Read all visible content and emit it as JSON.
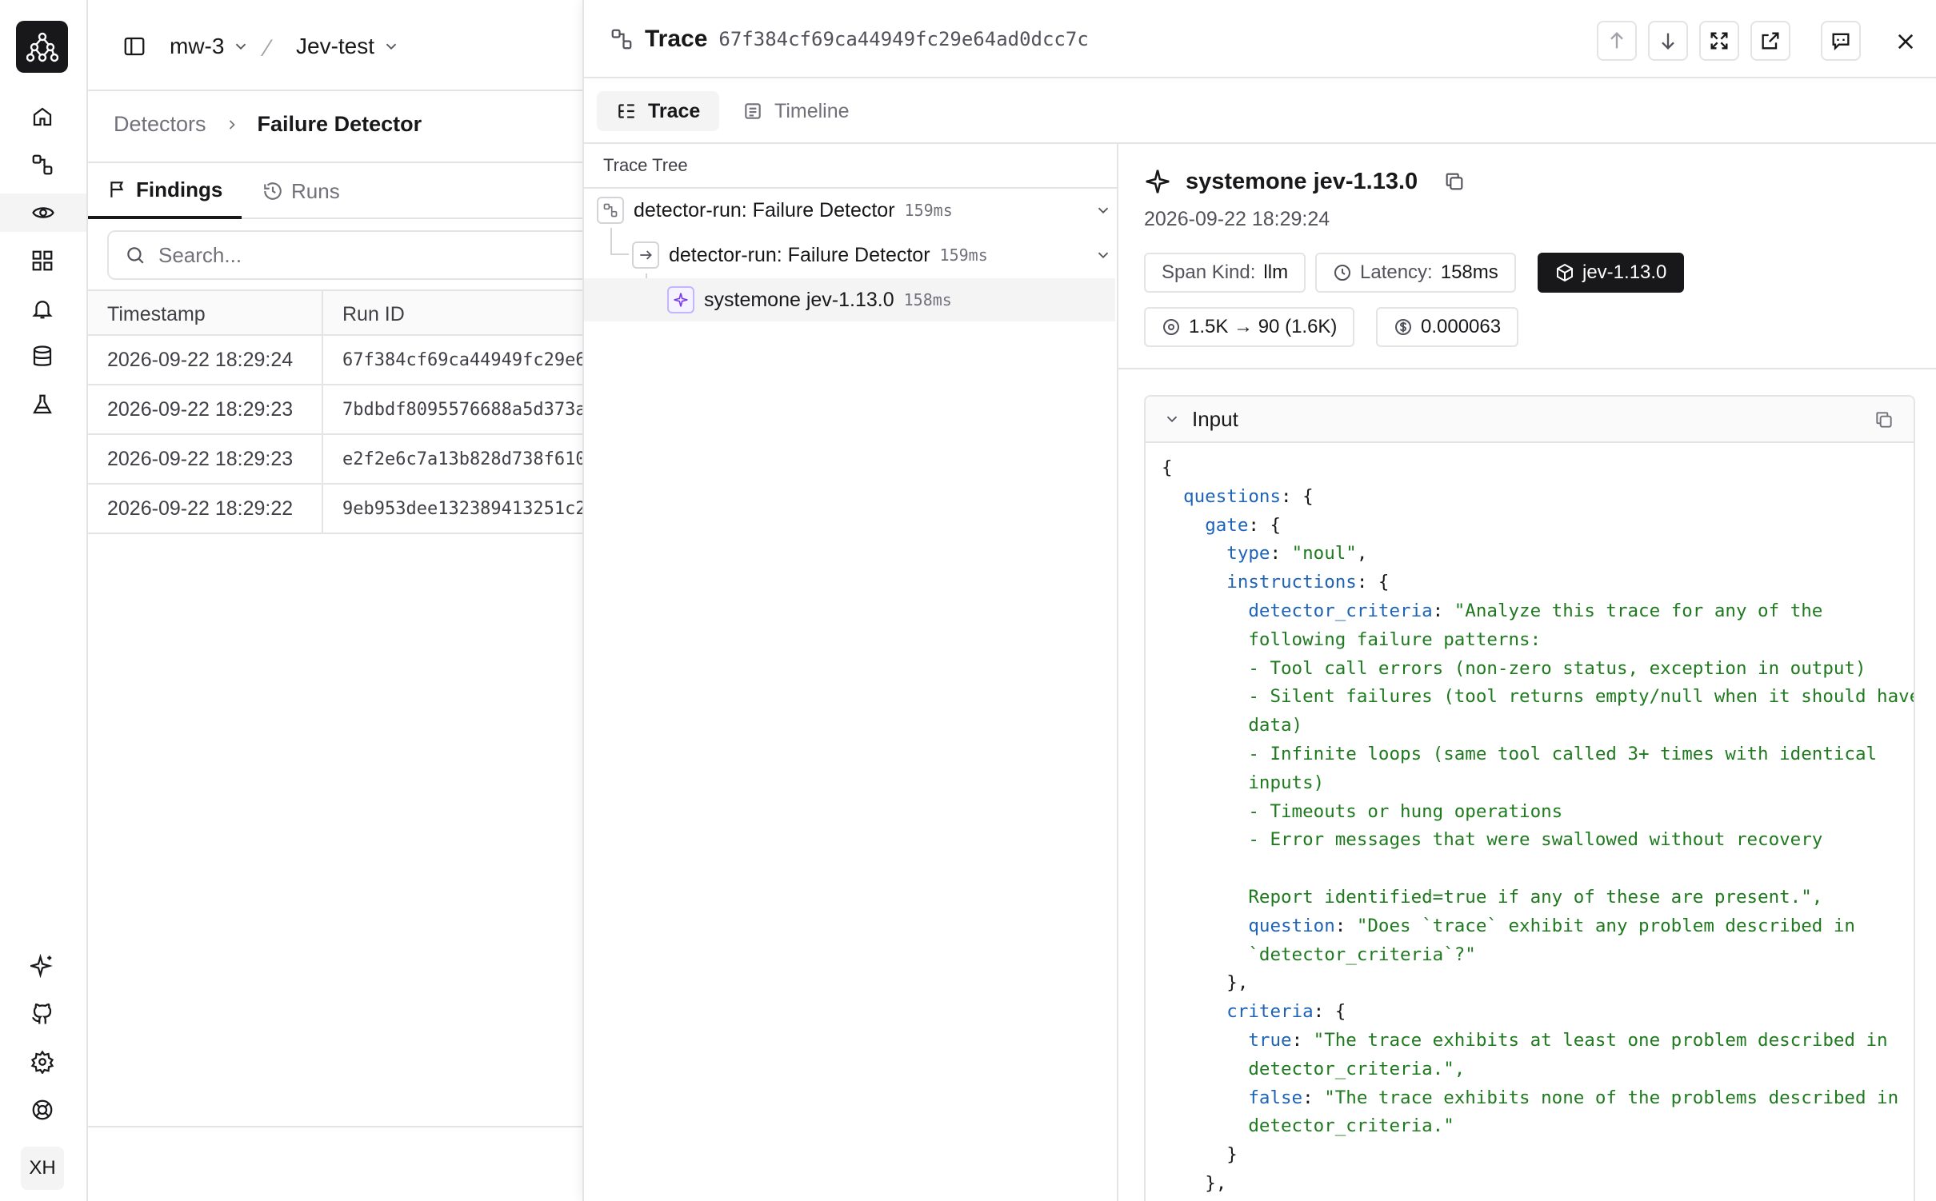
{
  "workspace": {
    "org": "mw-3",
    "project": "Jev-test"
  },
  "user": {
    "initials": "XH"
  },
  "rail": {
    "top_icons": [
      "home-icon",
      "traces-icon",
      "eye-icon",
      "dashboard-icon",
      "bell-icon",
      "database-icon",
      "flask-icon"
    ],
    "active": "eye-icon",
    "bottom_icons": [
      "sparkle-icon",
      "github-icon",
      "settings-icon",
      "help-icon"
    ]
  },
  "breadcrumb": {
    "parent": "Detectors",
    "current": "Failure Detector"
  },
  "tabs": {
    "findings": "Findings",
    "runs": "Runs"
  },
  "search": {
    "placeholder": "Search..."
  },
  "runs_table": {
    "columns": [
      "Timestamp",
      "Run ID"
    ],
    "rows": [
      {
        "timestamp": "2026-09-22 18:29:24",
        "run_id": "67f384cf69ca44949fc29e6"
      },
      {
        "timestamp": "2026-09-22 18:29:23",
        "run_id": "7bdbdf8095576688a5d373a"
      },
      {
        "timestamp": "2026-09-22 18:29:23",
        "run_id": "e2f2e6c7a13b828d738f610"
      },
      {
        "timestamp": "2026-09-22 18:29:22",
        "run_id": "9eb953dee132389413251c2"
      }
    ]
  },
  "drawer": {
    "title": "Trace",
    "trace_id": "67f384cf69ca44949fc29e64ad0dcc7c",
    "tabs": {
      "trace": "Trace",
      "timeline": "Timeline"
    },
    "tree_title": "Trace Tree",
    "nodes": [
      {
        "name": "detector-run: Failure Detector",
        "duration": "159ms"
      },
      {
        "name": "detector-run: Failure Detector",
        "duration": "159ms"
      },
      {
        "name": "systemone jev-1.13.0",
        "duration": "158ms"
      }
    ],
    "span": {
      "name": "systemone jev-1.13.0",
      "timestamp": "2026-09-22 18:29:24",
      "kind_label": "Span Kind:",
      "kind": "llm",
      "latency_label": "Latency:",
      "latency": "158ms",
      "version": "jev-1.13.0",
      "tokens": "1.5K → 90 (1.6K)",
      "cost": "0.000063"
    },
    "input_label": "Input",
    "input_code": {
      "l0": "{",
      "k_questions": "questions",
      "k_gate": "gate",
      "k_type": "type",
      "v_type": "\"noul\"",
      "k_instructions": "instructions",
      "k_detector_criteria": "detector_criteria",
      "v_dc1": "\"Analyze this trace for any of the",
      "v_dc2": "following failure patterns:",
      "v_dc3": "- Tool call errors (non-zero status, exception in output)",
      "v_dc4": "- Silent failures (tool returns empty/null when it should have",
      "v_dc5": "data)",
      "v_dc6": "- Infinite loops (same tool called 3+ times with identical",
      "v_dc7": "inputs)",
      "v_dc8": "- Timeouts or hung operations",
      "v_dc9": "- Error messages that were swallowed without recovery",
      "v_dc10": "Report identified=true if any of these are present.\",",
      "k_question": "question",
      "v_q1": "\"Does `trace` exhibit any problem described in",
      "v_q2": "`detector_criteria`?\"",
      "l_close1": "},",
      "k_criteria": "criteria",
      "k_true": "true",
      "v_t1": "\"The trace exhibits at least one problem described in",
      "v_t2": "detector_criteria.\",",
      "k_false": "false",
      "v_f1": "\"The trace exhibits none of the problems described in",
      "v_f2": "detector_criteria.\"",
      "l_close2": "}",
      "l_close3": "},"
    }
  },
  "colors": {
    "accent_dark": "#18181b",
    "json_key": "#1d63b8",
    "json_string": "#1f7a1f",
    "border": "#e4e4e7"
  }
}
